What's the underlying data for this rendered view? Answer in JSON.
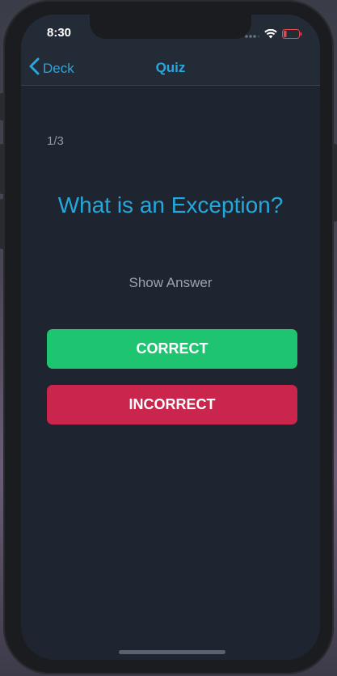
{
  "status_bar": {
    "time": "8:30",
    "icons": [
      "signal-dots-icon",
      "wifi-icon",
      "battery-low-icon"
    ],
    "battery_color": "#e5484d"
  },
  "nav": {
    "back_label": "Deck",
    "title": "Quiz"
  },
  "quiz": {
    "counter": "1/3",
    "question": "What is an Exception?",
    "show_answer_label": "Show Answer",
    "correct_label": "CORRECT",
    "incorrect_label": "INCORRECT"
  },
  "colors": {
    "accent": "#2aa6de",
    "correct": "#1ec46f",
    "incorrect": "#c9254d",
    "background": "#1f2530"
  }
}
